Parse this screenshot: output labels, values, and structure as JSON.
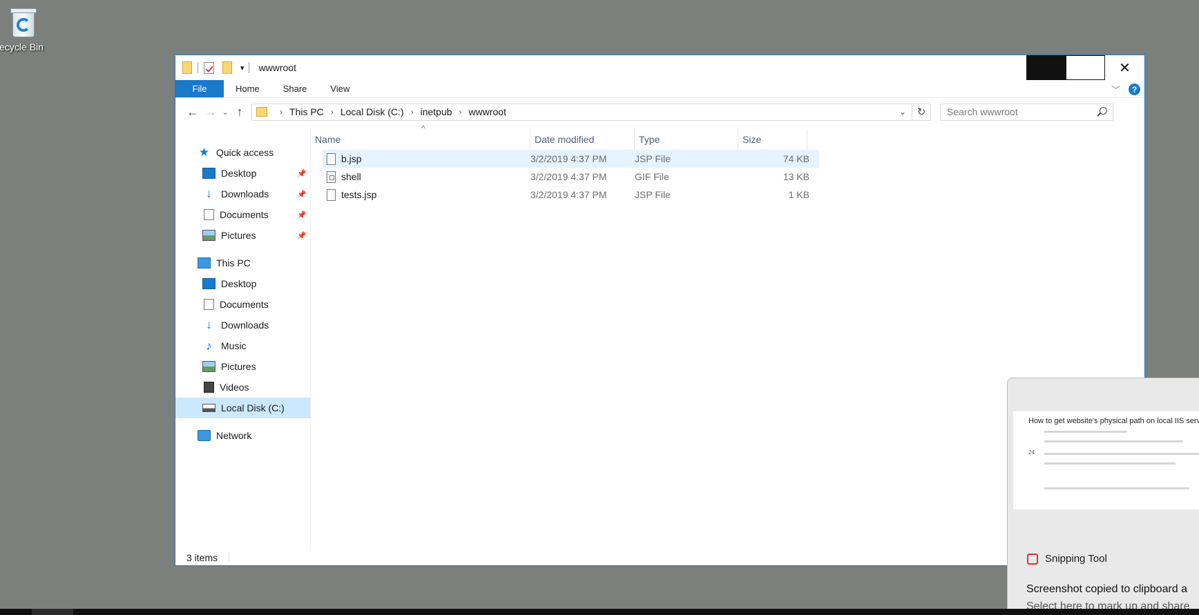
{
  "desktop": {
    "recycle_bin_label": "Recycle Bin"
  },
  "window": {
    "title": "wwwroot",
    "ribbon_tabs": [
      "File",
      "Home",
      "Share",
      "View"
    ],
    "help_label": "?"
  },
  "navbar": {
    "crumbs": [
      "This PC",
      "Local Disk (C:)",
      "inetpub",
      "wwwroot"
    ],
    "search_placeholder": "Search wwwroot"
  },
  "sidebar": {
    "quick_access": "Quick access",
    "quick_items": [
      {
        "label": "Desktop",
        "icon": "desktop-icon"
      },
      {
        "label": "Downloads",
        "icon": "downloads-icon"
      },
      {
        "label": "Documents",
        "icon": "documents-icon"
      },
      {
        "label": "Pictures",
        "icon": "pictures-icon"
      }
    ],
    "this_pc": "This PC",
    "pc_items": [
      {
        "label": "Desktop",
        "icon": "desktop-icon"
      },
      {
        "label": "Documents",
        "icon": "documents-icon"
      },
      {
        "label": "Downloads",
        "icon": "downloads-icon"
      },
      {
        "label": "Music",
        "icon": "music-icon"
      },
      {
        "label": "Pictures",
        "icon": "pictures-icon"
      },
      {
        "label": "Videos",
        "icon": "videos-icon"
      },
      {
        "label": "Local Disk (C:)",
        "icon": "disk-icon"
      }
    ],
    "network": "Network"
  },
  "file_list": {
    "columns": [
      "Name",
      "Date modified",
      "Type",
      "Size"
    ],
    "rows": [
      {
        "name": "b.jsp",
        "date": "3/2/2019 4:37 PM",
        "type": "JSP File",
        "size": "74 KB"
      },
      {
        "name": "shell",
        "date": "3/2/2019 4:37 PM",
        "type": "GIF File",
        "size": "13 KB"
      },
      {
        "name": "tests.jsp",
        "date": "3/2/2019 4:37 PM",
        "type": "JSP File",
        "size": "1 KB"
      }
    ]
  },
  "status": {
    "item_count": "3 items"
  },
  "toast": {
    "preview_title": "How to get website's physical path on local IIS server?",
    "preview_votes": "24",
    "app_name": "Snipping Tool",
    "message": "Screenshot copied to clipboard a",
    "sub_message": "Select here to mark up and share"
  },
  "colors": {
    "accent": "#1979ca",
    "desktop": "#7b807d",
    "selection": "#cce8ff"
  }
}
